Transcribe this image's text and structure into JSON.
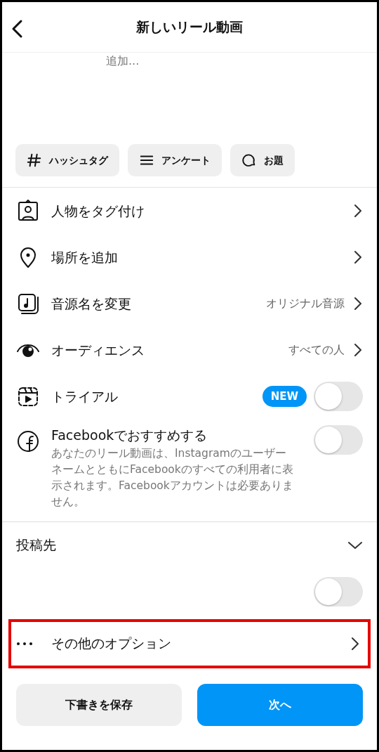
{
  "header": {
    "title": "新しいリール動画"
  },
  "caption": {
    "placeholder": "追加..."
  },
  "chips": [
    {
      "label": "ハッシュタグ"
    },
    {
      "label": "アンケート"
    },
    {
      "label": "お題"
    }
  ],
  "rows": [
    {
      "kind": "link",
      "label": "人物をタグ付け"
    },
    {
      "kind": "link",
      "label": "場所を追加"
    },
    {
      "kind": "link",
      "label": "音源名を変更",
      "value": "オリジナル音源"
    },
    {
      "kind": "link",
      "label": "オーディエンス",
      "value": "すべての人"
    },
    {
      "kind": "toggle",
      "label": "トライアル",
      "badge": "NEW",
      "on": false
    },
    {
      "kind": "toggle",
      "label": "Facebookでおすすめする",
      "description": "あなたのリール動画は、InstagramのユーザーネームとともにFacebookのすべての利用者に表示されます。Facebookアカウントは必要ありません。",
      "on": false
    }
  ],
  "share_to": {
    "label": "投稿先",
    "expanded": true,
    "toggles": [
      {
        "on": false
      }
    ]
  },
  "more_options": {
    "label": "その他のオプション",
    "highlighted": true
  },
  "buttons": [
    {
      "kind": "secondary",
      "label": "下書きを保存"
    },
    {
      "kind": "primary",
      "label": "次へ"
    }
  ]
}
